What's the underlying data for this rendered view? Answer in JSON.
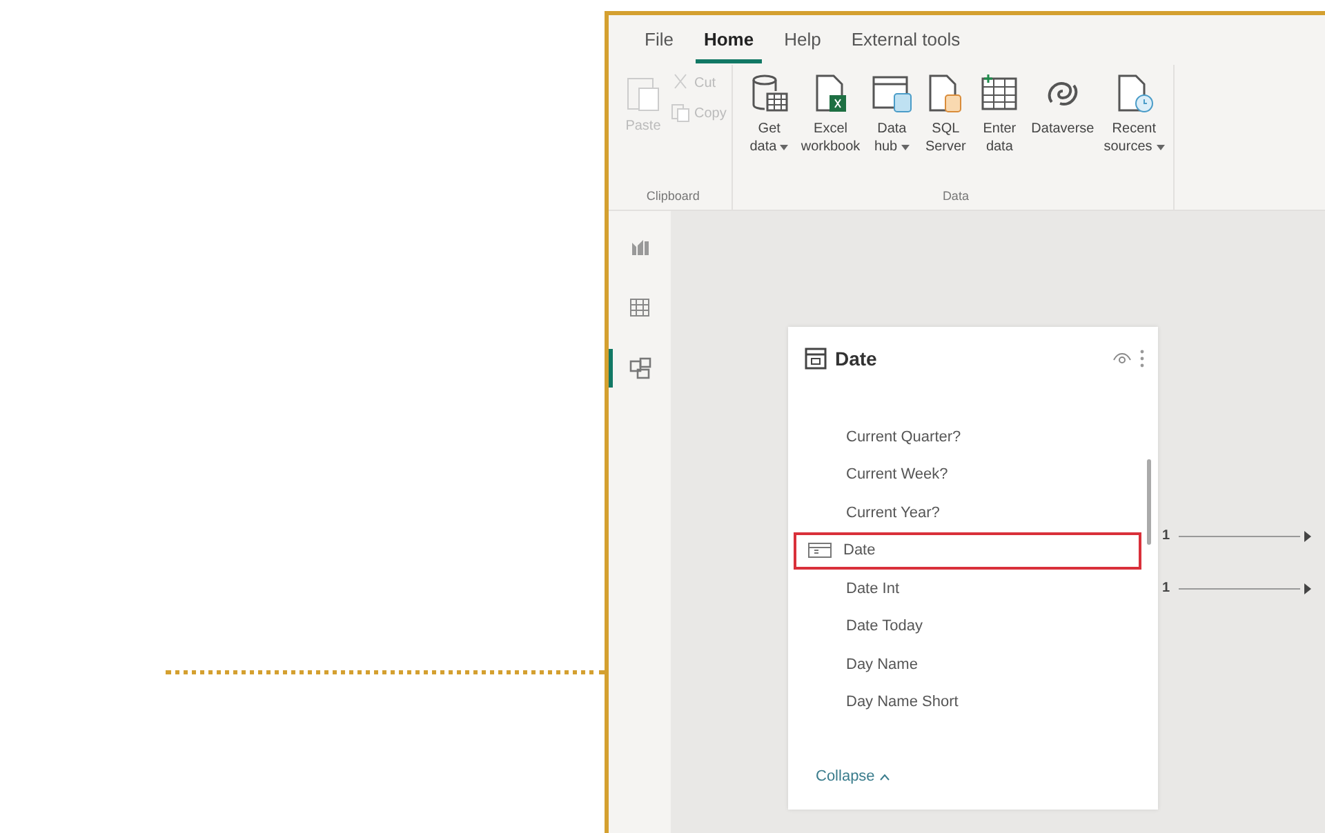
{
  "tabs": [
    {
      "label": "File",
      "selected": false
    },
    {
      "label": "Home",
      "selected": true
    },
    {
      "label": "Help",
      "selected": false
    },
    {
      "label": "External tools",
      "selected": false
    }
  ],
  "ribbon_groups": [
    {
      "label": "Clipboard",
      "disabled": true,
      "buttons": [
        {
          "kind": "paste",
          "lines": [
            "Paste"
          ]
        },
        {
          "kind": "cut",
          "lines": [
            "Cut"
          ]
        },
        {
          "kind": "copy",
          "lines": [
            "Copy"
          ]
        }
      ]
    },
    {
      "label": "Data",
      "disabled": false,
      "buttons": [
        {
          "kind": "database",
          "lines": [
            "Get",
            "data"
          ],
          "dropdown": true
        },
        {
          "kind": "excel",
          "lines": [
            "Excel",
            "workbook"
          ]
        },
        {
          "kind": "hub",
          "lines": [
            "Data",
            "hub"
          ],
          "dropdown": true
        },
        {
          "kind": "sql",
          "lines": [
            "SQL",
            "Server"
          ]
        },
        {
          "kind": "table",
          "lines": [
            "Enter",
            "data"
          ]
        },
        {
          "kind": "dataverse",
          "lines": [
            "Dataverse"
          ]
        },
        {
          "kind": "recent",
          "lines": [
            "Recent",
            "sources"
          ],
          "dropdown": true
        }
      ]
    }
  ],
  "rail": [
    {
      "kind": "report",
      "selected": false
    },
    {
      "kind": "table",
      "selected": false
    },
    {
      "kind": "model",
      "selected": true
    }
  ],
  "table_card": {
    "title": "Date",
    "fields": [
      {
        "name": "Current Quarter?",
        "kind": "field",
        "selected": false
      },
      {
        "name": "Current Week?",
        "kind": "field",
        "selected": false
      },
      {
        "name": "Current Year?",
        "kind": "field",
        "selected": false
      },
      {
        "name": "Date",
        "kind": "date",
        "selected": true
      },
      {
        "name": "Date Int",
        "kind": "field",
        "selected": false
      },
      {
        "name": "Date Today",
        "kind": "field",
        "selected": false
      },
      {
        "name": "Day Name",
        "kind": "field",
        "selected": false
      },
      {
        "name": "Day Name Short",
        "kind": "field",
        "selected": false
      }
    ],
    "collapse": "Collapse"
  },
  "relationships": [
    {
      "cardinality": "1"
    },
    {
      "cardinality": "1"
    }
  ]
}
